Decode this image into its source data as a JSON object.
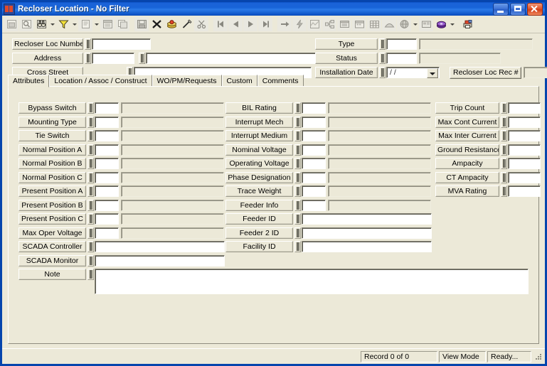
{
  "window": {
    "title": "Recloser Location - No Filter",
    "icon": "app-icon",
    "buttons": {
      "minimize": "minimize",
      "maximize": "maximize",
      "close": "close"
    }
  },
  "toolbar": {
    "groups": [
      {
        "items": [
          {
            "name": "form-view-button",
            "icon": "window-icon",
            "disabled": true
          },
          {
            "name": "query-button",
            "icon": "magnifier-doc-icon",
            "disabled": true
          },
          {
            "name": "find-button",
            "icon": "binoculars-icon",
            "disabled": false,
            "dropdown": true
          },
          {
            "name": "filter-button",
            "icon": "funnel-icon",
            "disabled": false,
            "dropdown": true
          },
          {
            "name": "report-button",
            "icon": "report-icon",
            "disabled": true,
            "dropdown": true
          },
          {
            "name": "properties-button",
            "icon": "properties-icon",
            "disabled": true
          },
          {
            "name": "copy-record-button",
            "icon": "copy-record-icon",
            "disabled": true
          }
        ]
      },
      {
        "items": [
          {
            "name": "save-button",
            "icon": "floppy-disk-icon",
            "disabled": true
          },
          {
            "name": "delete-button",
            "icon": "black-x-icon",
            "disabled": false
          },
          {
            "name": "new-record-button",
            "icon": "stack-icon",
            "disabled": false
          },
          {
            "name": "edit-button",
            "icon": "pencil-icon",
            "disabled": false
          },
          {
            "name": "cut-button",
            "icon": "scissors-icon",
            "disabled": true
          }
        ]
      },
      {
        "items": [
          {
            "name": "first-record-button",
            "icon": "first-record-icon",
            "disabled": true
          },
          {
            "name": "previous-record-button",
            "icon": "previous-record-icon",
            "disabled": true
          },
          {
            "name": "next-record-button",
            "icon": "next-record-icon",
            "disabled": true
          },
          {
            "name": "last-record-button",
            "icon": "last-record-icon",
            "disabled": true
          }
        ]
      },
      {
        "items": [
          {
            "name": "goto-button",
            "icon": "right-arrow-icon",
            "disabled": true
          },
          {
            "name": "lightning-button",
            "icon": "lightning-icon",
            "disabled": true
          },
          {
            "name": "map-button",
            "icon": "map-icon",
            "disabled": true
          },
          {
            "name": "tree-button",
            "icon": "tree-icon",
            "disabled": true
          },
          {
            "name": "list-button",
            "icon": "list-window-icon",
            "disabled": true
          },
          {
            "name": "calendar-button",
            "icon": "calendar-icon",
            "disabled": true
          },
          {
            "name": "grid-button",
            "icon": "grid-icon",
            "disabled": true
          },
          {
            "name": "pipe-button",
            "icon": "pipe-icon",
            "disabled": true
          },
          {
            "name": "globe-button",
            "icon": "globe-icon",
            "disabled": true,
            "dropdown": true
          },
          {
            "name": "card-button",
            "icon": "card-icon",
            "disabled": true
          },
          {
            "name": "attachment-button",
            "icon": "purple-disc-icon",
            "disabled": false,
            "dropdown": true
          }
        ]
      },
      {
        "items": [
          {
            "name": "print-preview-button",
            "icon": "printer-icon",
            "disabled": false
          }
        ]
      }
    ]
  },
  "header_fields": {
    "left": [
      {
        "label": "Recloser Loc Number",
        "name": "recloser-loc-number",
        "value": "",
        "kind": "text-wide"
      },
      {
        "label": "Address",
        "name": "address",
        "value": "",
        "second_value": "",
        "kind": "text-dual"
      },
      {
        "label": "Cross Street",
        "name": "cross-street",
        "value": "",
        "kind": "text-offset"
      }
    ],
    "right": [
      {
        "label": "Type",
        "name": "type",
        "value": "",
        "desc": "",
        "kind": "code-desc"
      },
      {
        "label": "Status",
        "name": "status",
        "value": "",
        "desc": "",
        "kind": "code-desc"
      },
      {
        "label": "Installation Date",
        "name": "installation-date",
        "value": "/ /",
        "kind": "date-combo"
      }
    ],
    "record_button": {
      "label": "Recloser Loc Rec #",
      "name": "recloser-loc-rec-number-button",
      "value": ""
    }
  },
  "tabs": [
    {
      "label": "Attributes",
      "name": "tab-attributes",
      "selected": true
    },
    {
      "label": "Location / Assoc / Construct",
      "name": "tab-location-assoc-construct",
      "selected": false
    },
    {
      "label": "WO/PM/Requests",
      "name": "tab-wo-pm-requests",
      "selected": false
    },
    {
      "label": "Custom",
      "name": "tab-custom",
      "selected": false
    },
    {
      "label": "Comments",
      "name": "tab-comments",
      "selected": false
    }
  ],
  "attributes": {
    "column1": [
      {
        "label": "Bypass Switch",
        "name": "bypass-switch",
        "value": "",
        "desc": "",
        "kind": "code-desc"
      },
      {
        "label": "Mounting Type",
        "name": "mounting-type",
        "value": "",
        "desc": "",
        "kind": "code-desc"
      },
      {
        "label": "Tie Switch",
        "name": "tie-switch",
        "value": "",
        "desc": "",
        "kind": "code-desc"
      },
      {
        "label": "Normal Position A",
        "name": "normal-position-a",
        "value": "",
        "desc": "",
        "kind": "code-desc"
      },
      {
        "label": "Normal Position B",
        "name": "normal-position-b",
        "value": "",
        "desc": "",
        "kind": "code-desc"
      },
      {
        "label": "Normal Position C",
        "name": "normal-position-c",
        "value": "",
        "desc": "",
        "kind": "code-desc"
      },
      {
        "label": "Present Position A",
        "name": "present-position-a",
        "value": "",
        "desc": "",
        "kind": "code-desc"
      },
      {
        "label": "Present Position B",
        "name": "present-position-b",
        "value": "",
        "desc": "",
        "kind": "code-desc"
      },
      {
        "label": "Present Position C",
        "name": "present-position-c",
        "value": "",
        "desc": "",
        "kind": "code-desc"
      },
      {
        "label": "Max Oper Voltage",
        "name": "max-oper-voltage",
        "value": "",
        "desc": "",
        "kind": "code-desc"
      },
      {
        "label": "SCADA Controller",
        "name": "scada-controller",
        "value": "",
        "kind": "wide"
      },
      {
        "label": "SCADA Monitor",
        "name": "scada-monitor",
        "value": "",
        "kind": "wide"
      },
      {
        "label": "Note",
        "name": "note",
        "value": "",
        "kind": "memo"
      }
    ],
    "column2": [
      {
        "label": "BIL Rating",
        "name": "bil-rating",
        "value": "",
        "desc": "",
        "kind": "code-desc"
      },
      {
        "label": "Interrupt Mech",
        "name": "interrupt-mech",
        "value": "",
        "desc": "",
        "kind": "code-desc"
      },
      {
        "label": "Interrupt Medium",
        "name": "interrupt-medium",
        "value": "",
        "desc": "",
        "kind": "code-desc"
      },
      {
        "label": "Nominal Voltage",
        "name": "nominal-voltage",
        "value": "",
        "desc": "",
        "kind": "code-desc"
      },
      {
        "label": "Operating Voltage",
        "name": "operating-voltage",
        "value": "",
        "desc": "",
        "kind": "code-desc"
      },
      {
        "label": "Phase Designation",
        "name": "phase-designation",
        "value": "",
        "desc": "",
        "kind": "code-desc"
      },
      {
        "label": "Trace Weight",
        "name": "trace-weight",
        "value": "",
        "desc": "",
        "kind": "code-desc"
      },
      {
        "label": "Feeder Info",
        "name": "feeder-info",
        "value": "",
        "desc": "",
        "kind": "code-desc"
      },
      {
        "label": "Feeder ID",
        "name": "feeder-id",
        "value": "",
        "kind": "wide"
      },
      {
        "label": "Feeder 2 ID",
        "name": "feeder-2-id",
        "value": "",
        "kind": "wide"
      },
      {
        "label": "Facility ID",
        "name": "facility-id",
        "value": "",
        "kind": "wide"
      }
    ],
    "column3": [
      {
        "label": "Trip Count",
        "name": "trip-count",
        "value": "",
        "kind": "short"
      },
      {
        "label": "Max Cont Current",
        "name": "max-cont-current",
        "value": "",
        "kind": "short"
      },
      {
        "label": "Max Inter Current",
        "name": "max-inter-current",
        "value": "",
        "kind": "short"
      },
      {
        "label": "Ground Resistance",
        "name": "ground-resistance",
        "value": "",
        "kind": "short"
      },
      {
        "label": "Ampacity",
        "name": "ampacity",
        "value": "",
        "kind": "short"
      },
      {
        "label": "CT Ampacity",
        "name": "ct-ampacity",
        "value": "",
        "kind": "short"
      },
      {
        "label": "MVA Rating",
        "name": "mva-rating",
        "value": "",
        "kind": "short"
      }
    ]
  },
  "statusbar": {
    "record": "Record 0 of 0",
    "mode": "View Mode",
    "state": "Ready..."
  },
  "colors": {
    "title_blue": "#0a52c8",
    "face": "#ece9d8",
    "frame": "#0645ad",
    "field_white": "#ffffff",
    "readonly": "#ece9d8"
  }
}
